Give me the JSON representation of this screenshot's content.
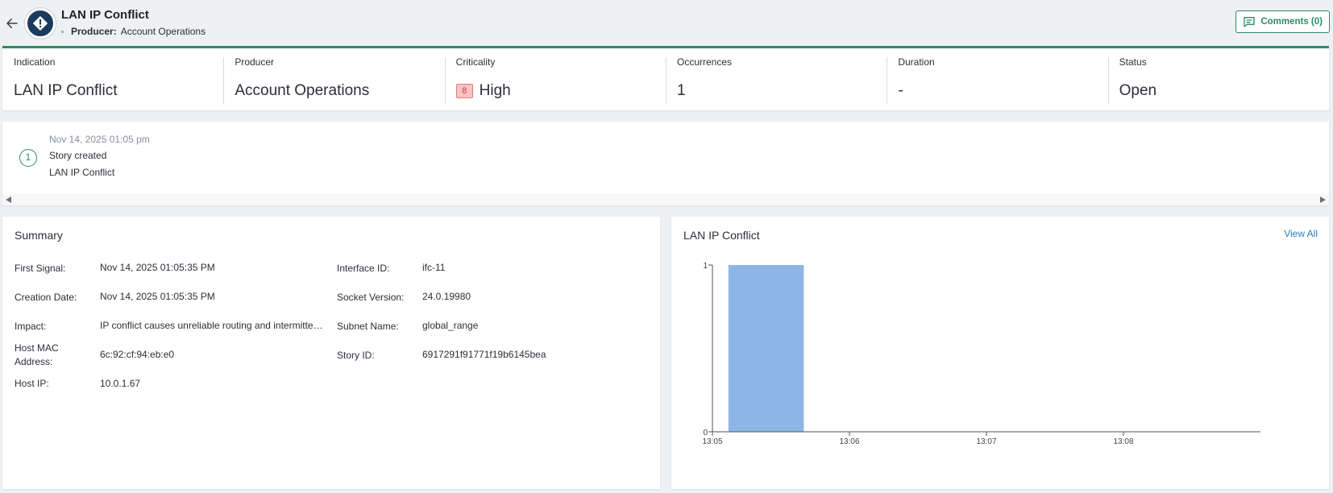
{
  "header": {
    "title": "LAN IP Conflict",
    "producer_label": "Producer:",
    "producer_value": "Account Operations",
    "comments_label": "Comments (0)"
  },
  "metrics": [
    {
      "label": "Indication",
      "value": "LAN IP Conflict"
    },
    {
      "label": "Producer",
      "value": "Account Operations"
    },
    {
      "label": "Criticality",
      "value": "High",
      "badge": "8"
    },
    {
      "label": "Occurrences",
      "value": "1"
    },
    {
      "label": "Duration",
      "value": "-"
    },
    {
      "label": "Status",
      "value": "Open"
    }
  ],
  "timeline": {
    "date": "Nov 14, 2025 01:05 pm",
    "step": "1",
    "event": "Story created",
    "description": "LAN IP Conflict"
  },
  "summary": {
    "title": "Summary",
    "left_fields": [
      {
        "label": "First Signal:",
        "value": "Nov 14, 2025 01:05:35 PM"
      },
      {
        "label": "Creation Date:",
        "value": "Nov 14, 2025 01:05:35 PM"
      },
      {
        "label": "Impact:",
        "value": "IP conflict causes unreliable routing and intermittent connectivity"
      },
      {
        "label": "Host MAC Address:",
        "value": "6c:92:cf:94:eb:e0"
      },
      {
        "label": "Host IP:",
        "value": "10.0.1.67"
      }
    ],
    "right_fields": [
      {
        "label": "Interface ID:",
        "value": "ifc-11"
      },
      {
        "label": "Socket Version:",
        "value": "24.0.19980"
      },
      {
        "label": "Subnet Name:",
        "value": "global_range"
      },
      {
        "label": "Story ID:",
        "value": "6917291f91771f19b6145bea"
      }
    ]
  },
  "chart_panel": {
    "title": "LAN IP Conflict",
    "view_all_label": "View All"
  },
  "chart_data": {
    "type": "bar",
    "title": "LAN IP Conflict",
    "xlabel": "",
    "ylabel": "",
    "x_ticks": [
      "13:05",
      "13:06",
      "13:07",
      "13:08"
    ],
    "y_ticks": [
      "0",
      "1"
    ],
    "ylim": [
      0,
      1
    ],
    "bars": [
      {
        "start": "13:05:07",
        "end": "13:05:40",
        "value": 1
      }
    ],
    "bar_color": "#8db6e6",
    "grid": false
  },
  "colors": {
    "accent": "#2e8b64",
    "link": "#2a7fc1",
    "critical": "#c93c3c"
  }
}
